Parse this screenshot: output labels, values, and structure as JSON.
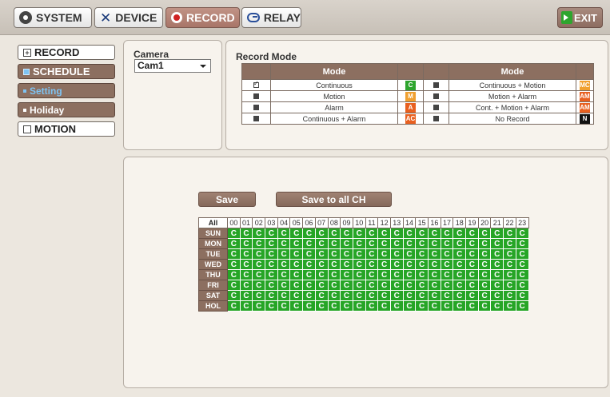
{
  "topbar": {
    "tabs": [
      {
        "label": "SYSTEM",
        "icon": "gear-icon"
      },
      {
        "label": "DEVICE",
        "icon": "tools-icon"
      },
      {
        "label": "RECORD",
        "icon": "record-icon",
        "active": true
      },
      {
        "label": "RELAY",
        "icon": "link-icon"
      }
    ],
    "exit_label": "EXIT"
  },
  "sidebar": {
    "items": [
      {
        "label": "RECORD"
      },
      {
        "label": "SCHEDULE"
      },
      {
        "label": "Setting"
      },
      {
        "label": "Holiday"
      },
      {
        "label": "MOTION"
      }
    ]
  },
  "camera": {
    "title": "Camera",
    "selected": "Cam1"
  },
  "record_mode": {
    "title": "Record Mode",
    "header": "Mode",
    "rows": [
      {
        "left": {
          "label": "Continuous",
          "code": "C",
          "color": "#2ea52e",
          "checked": true
        },
        "right": {
          "label": "Continuous + Motion",
          "code": "MC",
          "color": "#f0a030",
          "checked": false
        }
      },
      {
        "left": {
          "label": "Motion",
          "code": "M",
          "color": "#f0a030",
          "checked": false
        },
        "right": {
          "label": "Motion + Alarm",
          "code": "AM",
          "color": "#e86020",
          "checked": false
        }
      },
      {
        "left": {
          "label": "Alarm",
          "code": "A",
          "color": "#e86020",
          "checked": false
        },
        "right": {
          "label": "Cont. + Motion + Alarm",
          "code": "AM",
          "color": "#e86020",
          "checked": false
        }
      },
      {
        "left": {
          "label": "Continuous + Alarm",
          "code": "AC",
          "color": "#e86020",
          "checked": false
        },
        "right": {
          "label": "No Record",
          "code": "N",
          "color": "#111111",
          "checked": false
        }
      }
    ]
  },
  "schedule": {
    "save_label": "Save",
    "save_all_label": "Save to all CH",
    "all_label": "All",
    "hours": [
      "00",
      "01",
      "02",
      "03",
      "04",
      "05",
      "06",
      "07",
      "08",
      "09",
      "10",
      "11",
      "12",
      "13",
      "14",
      "15",
      "16",
      "17",
      "18",
      "19",
      "20",
      "21",
      "22",
      "23"
    ],
    "days": [
      "SUN",
      "MON",
      "TUE",
      "WED",
      "THU",
      "FRI",
      "SAT",
      "HOL"
    ],
    "cell_value": "C",
    "cell_color": "#26a526"
  }
}
